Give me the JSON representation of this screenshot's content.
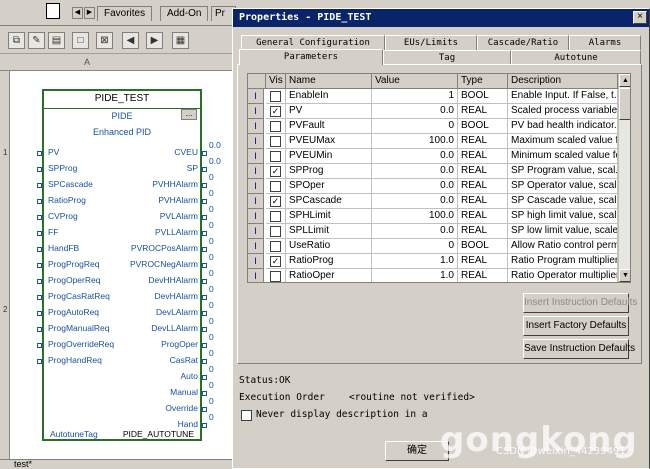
{
  "editor": {
    "top_tabs": [
      "Favorites",
      "Add-On",
      "Pr"
    ],
    "column_label": "A",
    "row_numbers": [
      "1",
      "2"
    ],
    "bottom_tab": "test*",
    "block": {
      "title": "PIDE_TEST",
      "sub": "PIDE",
      "dots": "...",
      "type": "Enhanced PID",
      "inputs": [
        "PV",
        "SPProg",
        "SPCascade",
        "RatioProg",
        "CVProg",
        "FF",
        "HandFB",
        "ProgProgReq",
        "ProgOperReq",
        "ProgCasRatReq",
        "ProgAutoReq",
        "ProgManualReq",
        "ProgOverrideReq",
        "ProgHandReq"
      ],
      "outputs": [
        "CVEU",
        "SP",
        "PVHHAlarm",
        "PVHAlarm",
        "PVLAlarm",
        "PVLLAlarm",
        "PVROCPosAlarm",
        "PVROCNegAlarm",
        "DevHHAlarm",
        "DevHAlarm",
        "DevLAlarm",
        "DevLLAlarm",
        "ProgOper",
        "CasRat",
        "Auto",
        "Manual",
        "Override",
        "Hand"
      ],
      "output_values": [
        "0.0",
        "0.0",
        "0",
        "0",
        "0",
        "0",
        "0",
        "0",
        "0",
        "0",
        "0",
        "0",
        "0",
        "0",
        "0",
        "0",
        "0",
        "0"
      ],
      "footer_left": "AutotuneTag",
      "footer_right": "PIDE_AUTOTUNE"
    }
  },
  "dialog": {
    "title": "Properties - PIDE_TEST",
    "close": "×",
    "tabs_row1": [
      "General Configuration",
      "EUs/Limits",
      "Cascade/Ratio",
      "Alarms"
    ],
    "tabs_row2": [
      "Parameters",
      "Tag",
      "Autotune"
    ],
    "grid": {
      "headers": [
        "Vis",
        "Name",
        "Value",
        "Type",
        "Description"
      ],
      "rows": [
        {
          "sel": "I",
          "vis": false,
          "name": "EnableIn",
          "value": "1",
          "type": "BOOL",
          "desc": "Enable Input.  If False, t..."
        },
        {
          "sel": "I",
          "vis": true,
          "name": "PV",
          "value": "0.0",
          "type": "REAL",
          "desc": "Scaled process variable ..."
        },
        {
          "sel": "I",
          "vis": false,
          "name": "PVFault",
          "value": "0",
          "type": "BOOL",
          "desc": "PV bad health indicator. ..."
        },
        {
          "sel": "I",
          "vis": false,
          "name": "PVEUMax",
          "value": "100.0",
          "type": "REAL",
          "desc": "Maximum scaled value f..."
        },
        {
          "sel": "I",
          "vis": false,
          "name": "PVEUMin",
          "value": "0.0",
          "type": "REAL",
          "desc": "Minimum scaled value fo..."
        },
        {
          "sel": "I",
          "vis": true,
          "name": "SPProg",
          "value": "0.0",
          "type": "REAL",
          "desc": " SP Program value, scal..."
        },
        {
          "sel": "I",
          "vis": false,
          "name": "SPOper",
          "value": "0.0",
          "type": "REAL",
          "desc": " SP Operator value, scal..."
        },
        {
          "sel": "I",
          "vis": true,
          "name": "SPCascade",
          "value": "0.0",
          "type": "REAL",
          "desc": " SP Cascade value, scal..."
        },
        {
          "sel": "I",
          "vis": false,
          "name": "SPHLimit",
          "value": "100.0",
          "type": "REAL",
          "desc": "SP high limit value, scal..."
        },
        {
          "sel": "I",
          "vis": false,
          "name": "SPLLimit",
          "value": "0.0",
          "type": "REAL",
          "desc": "SP low limit value, scale..."
        },
        {
          "sel": "I",
          "vis": false,
          "name": "UseRatio",
          "value": "0",
          "type": "BOOL",
          "desc": "Allow Ratio control permi..."
        },
        {
          "sel": "I",
          "vis": true,
          "name": "RatioProg",
          "value": "1.0",
          "type": "REAL",
          "desc": "Ratio Program multiplier, ..."
        },
        {
          "sel": "I",
          "vis": false,
          "name": "RatioOper",
          "value": "1.0",
          "type": "REAL",
          "desc": "Ratio Operator multiplier,..."
        }
      ]
    },
    "buttons": {
      "insert_instruction_defaults": "Insert Instruction Defaults",
      "insert_factory_defaults": "Insert Factory Defaults",
      "save_instruction_defaults": "Save Instruction Defaults",
      "ok": "确定"
    },
    "status": "Status:OK",
    "execution_order_label": "Execution Order",
    "execution_order_value": "<routine not verified>",
    "never_display": "Never display description in a"
  },
  "watermark": {
    "text": "gongkong",
    "sub": "CSDN @weixin_44239491"
  }
}
